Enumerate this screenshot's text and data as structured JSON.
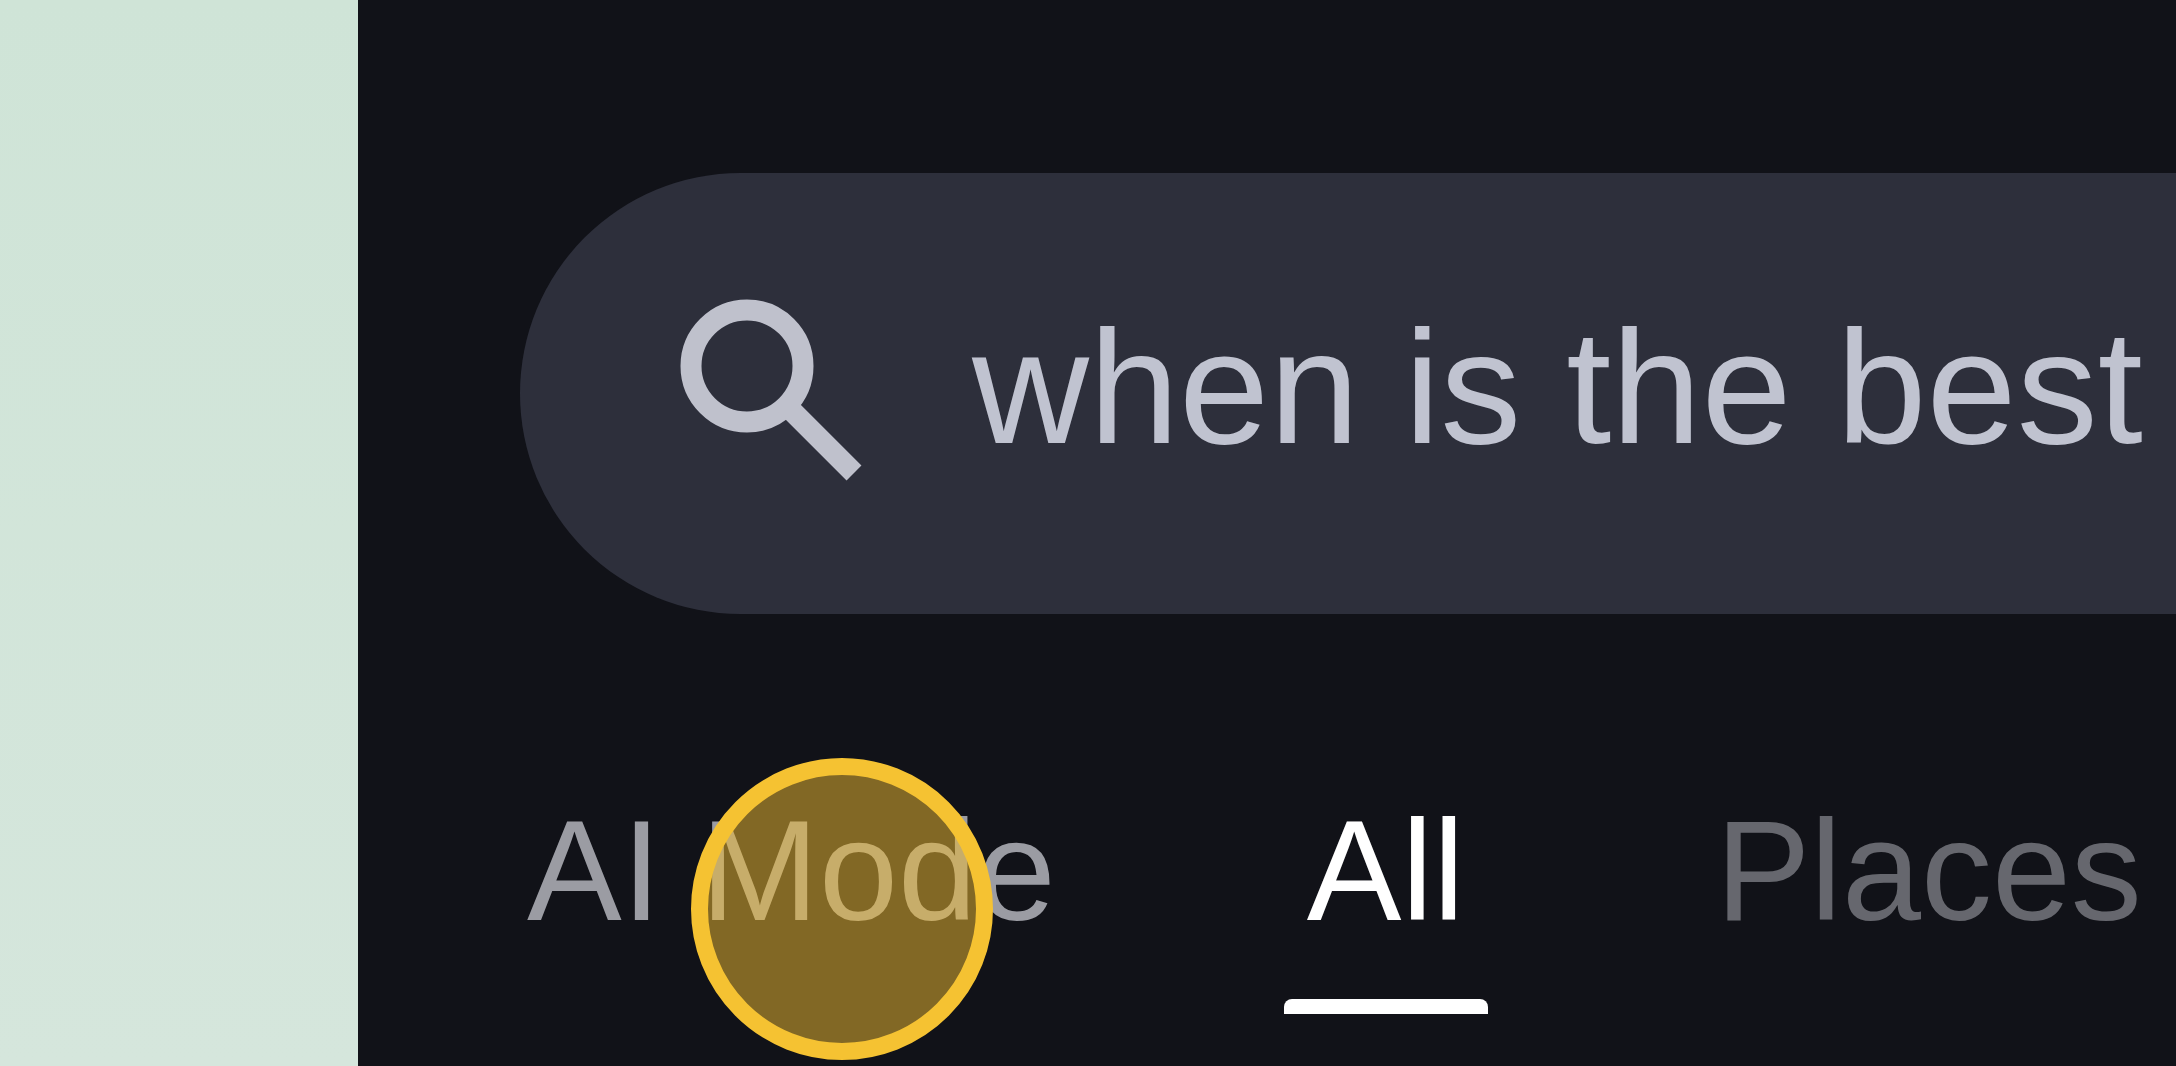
{
  "search": {
    "value": "when is the best"
  },
  "tabs": [
    {
      "label": "AI Mode",
      "selected": false
    },
    {
      "label": "All",
      "selected": true
    },
    {
      "label": "Places",
      "selected": false
    }
  ]
}
